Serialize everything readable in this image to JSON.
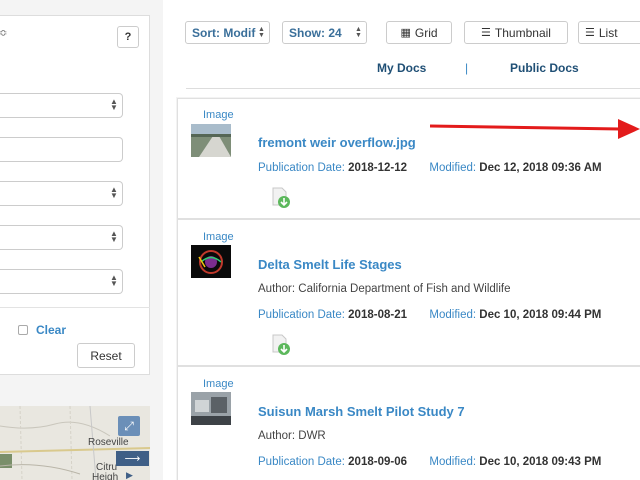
{
  "filter_panel": {
    "help_label": "?",
    "left_glyph": "≎",
    "clear_label": "Clear",
    "reset_label": "Reset"
  },
  "map": {
    "labels": [
      "Roseville",
      "Citru",
      "Heigh"
    ],
    "expand_icon": "expand-icon",
    "arrow_label": "⟶"
  },
  "toolbar": {
    "sort_label": "Sort: Modif",
    "show_label": "Show: 24",
    "grid_label": "Grid",
    "thumbnail_label": "Thumbnail",
    "list_label": "List"
  },
  "tabs": {
    "my_docs": "My Docs",
    "divider": "|",
    "public_docs": "Public Docs"
  },
  "documents": [
    {
      "type": "Image",
      "title": "fremont weir overflow.jpg",
      "author": "",
      "pub_label": "Publication Date:",
      "pub_date": "2018-12-12",
      "mod_label": "Modified:",
      "mod_date": "Dec 12, 2018 09:36 AM"
    },
    {
      "type": "Image",
      "title": "Delta Smelt Life Stages",
      "author": "Author: California Department of Fish and Wildlife",
      "pub_label": "Publication Date:",
      "pub_date": "2018-08-21",
      "mod_label": "Modified:",
      "mod_date": "Dec 10, 2018 09:44 PM"
    },
    {
      "type": "Image",
      "title": "Suisun Marsh Smelt Pilot Study 7",
      "author": "Author: DWR",
      "pub_label": "Publication Date:",
      "pub_date": "2018-09-06",
      "mod_label": "Modified:",
      "mod_date": "Dec 10, 2018 09:43 PM"
    }
  ],
  "colors": {
    "link_blue": "#3a88c5",
    "tab_navy": "#1f4f75",
    "arrow_red": "#e31b1b",
    "download_green": "#5cb85c"
  }
}
